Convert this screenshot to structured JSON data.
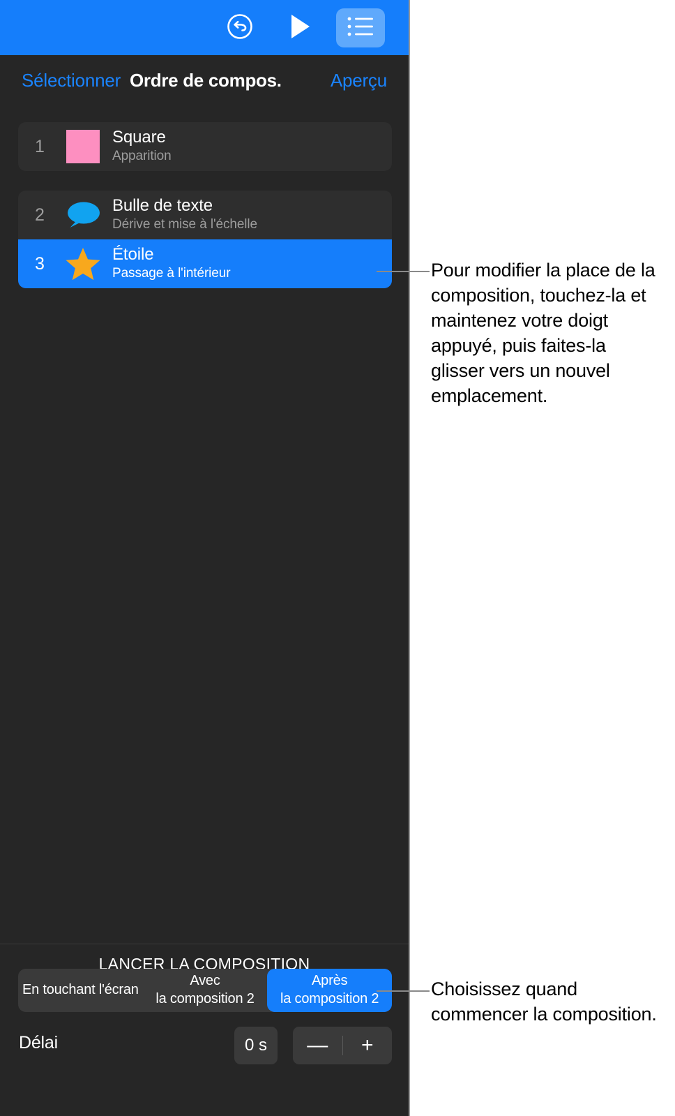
{
  "toolbar": {
    "undo_icon": "undo-circle-icon",
    "play_icon": "play-icon",
    "list_icon": "bullet-list-icon"
  },
  "header": {
    "select_label": "Sélectionner",
    "title": "Ordre de compos.",
    "preview_label": "Aperçu"
  },
  "build_list": [
    {
      "number": "1",
      "title": "Square",
      "subtitle": "Apparition",
      "icon": "pink-square-swatch",
      "selected": false
    },
    {
      "number": "2",
      "title": "Bulle de texte",
      "subtitle": "Dérive et mise à l'échelle",
      "icon": "speech-bubble-icon",
      "selected": false
    },
    {
      "number": "3",
      "title": "Étoile",
      "subtitle": "Passage à l'intérieur",
      "icon": "star-icon",
      "selected": true
    }
  ],
  "start_section": {
    "label": "LANCER LA COMPOSITION",
    "segments": [
      {
        "line1": "En touchant l'écran",
        "line2": "",
        "selected": false
      },
      {
        "line1": "Avec",
        "line2": "la composition 2",
        "selected": false
      },
      {
        "line1": "Après",
        "line2": "la composition 2",
        "selected": true
      }
    ],
    "delay_label": "Délai",
    "delay_value": "0 s",
    "minus_label": "—",
    "plus_label": "+"
  },
  "callouts": {
    "reorder": "Pour modifier la place de la composition, touchez-la et maintenez votre doigt appuyé, puis faites-la glisser vers un nouvel emplacement.",
    "start_timing": "Choisissez quand commencer la composition."
  },
  "colors": {
    "accent_blue": "#157efb",
    "link_blue": "#1a84ff",
    "panel_bg": "#262626",
    "row_bg": "#2e2e2e",
    "control_bg": "#3a3a3a",
    "pink_swatch": "#fd8fc0",
    "bubble_blue": "#11a3f0",
    "star_orange": "#f8a81d",
    "muted_text": "#9d9d9d"
  }
}
